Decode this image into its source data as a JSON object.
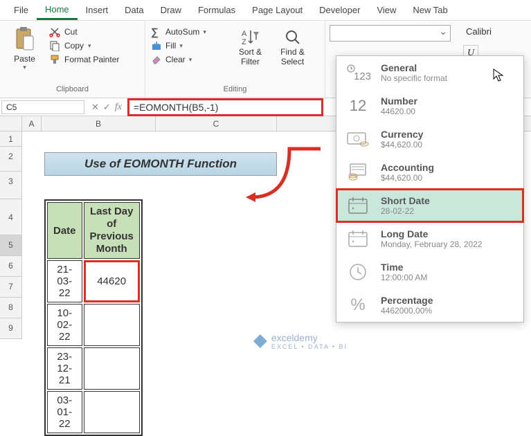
{
  "menu": {
    "items": [
      "File",
      "Home",
      "Insert",
      "Data",
      "Draw",
      "Formulas",
      "Page Layout",
      "Developer",
      "View",
      "New Tab"
    ],
    "active": "Home"
  },
  "ribbon": {
    "clipboard": {
      "paste": "Paste",
      "cut": "Cut",
      "copy": "Copy",
      "format_painter": "Format Painter",
      "label": "Clipboard"
    },
    "editing": {
      "autosum": "AutoSum",
      "fill": "Fill",
      "clear": "Clear",
      "sort_filter": "Sort &\nFilter",
      "find_select": "Find &\nSelect",
      "label": "Editing"
    },
    "font": {
      "name": "Calibri",
      "underline": "U"
    }
  },
  "namebox": "C5",
  "formula": "=EOMONTH(B5,-1)",
  "columns": [
    "A",
    "B",
    "C"
  ],
  "rows": [
    "1",
    "2",
    "3",
    "4",
    "5",
    "6",
    "7",
    "8",
    "9"
  ],
  "title": "Use of EOMONTH Function",
  "table": {
    "headers": {
      "date": "Date",
      "lastday": "Last Day of\nPrevious Month"
    },
    "rows": [
      {
        "date": "21-03-22",
        "value": "44620"
      },
      {
        "date": "10-02-22",
        "value": ""
      },
      {
        "date": "23-12-21",
        "value": ""
      },
      {
        "date": "03-01-22",
        "value": ""
      }
    ]
  },
  "format_options": [
    {
      "title": "General",
      "sub": "No specific format",
      "icon": "123"
    },
    {
      "title": "Number",
      "sub": "44620.00",
      "icon": "12"
    },
    {
      "title": "Currency",
      "sub": "$44,620.00",
      "icon": "cash"
    },
    {
      "title": "Accounting",
      "sub": "$44,620.00",
      "icon": "coins"
    },
    {
      "title": "Short Date",
      "sub": "28-02-22",
      "icon": "cal"
    },
    {
      "title": "Long Date",
      "sub": "Monday, February 28, 2022",
      "icon": "cal"
    },
    {
      "title": "Time",
      "sub": "12:00:00 AM",
      "icon": "clock"
    },
    {
      "title": "Percentage",
      "sub": "4462000.00%",
      "icon": "%"
    }
  ],
  "watermark": {
    "brand": "exceldemy",
    "tag": "EXCEL • DATA • BI"
  }
}
